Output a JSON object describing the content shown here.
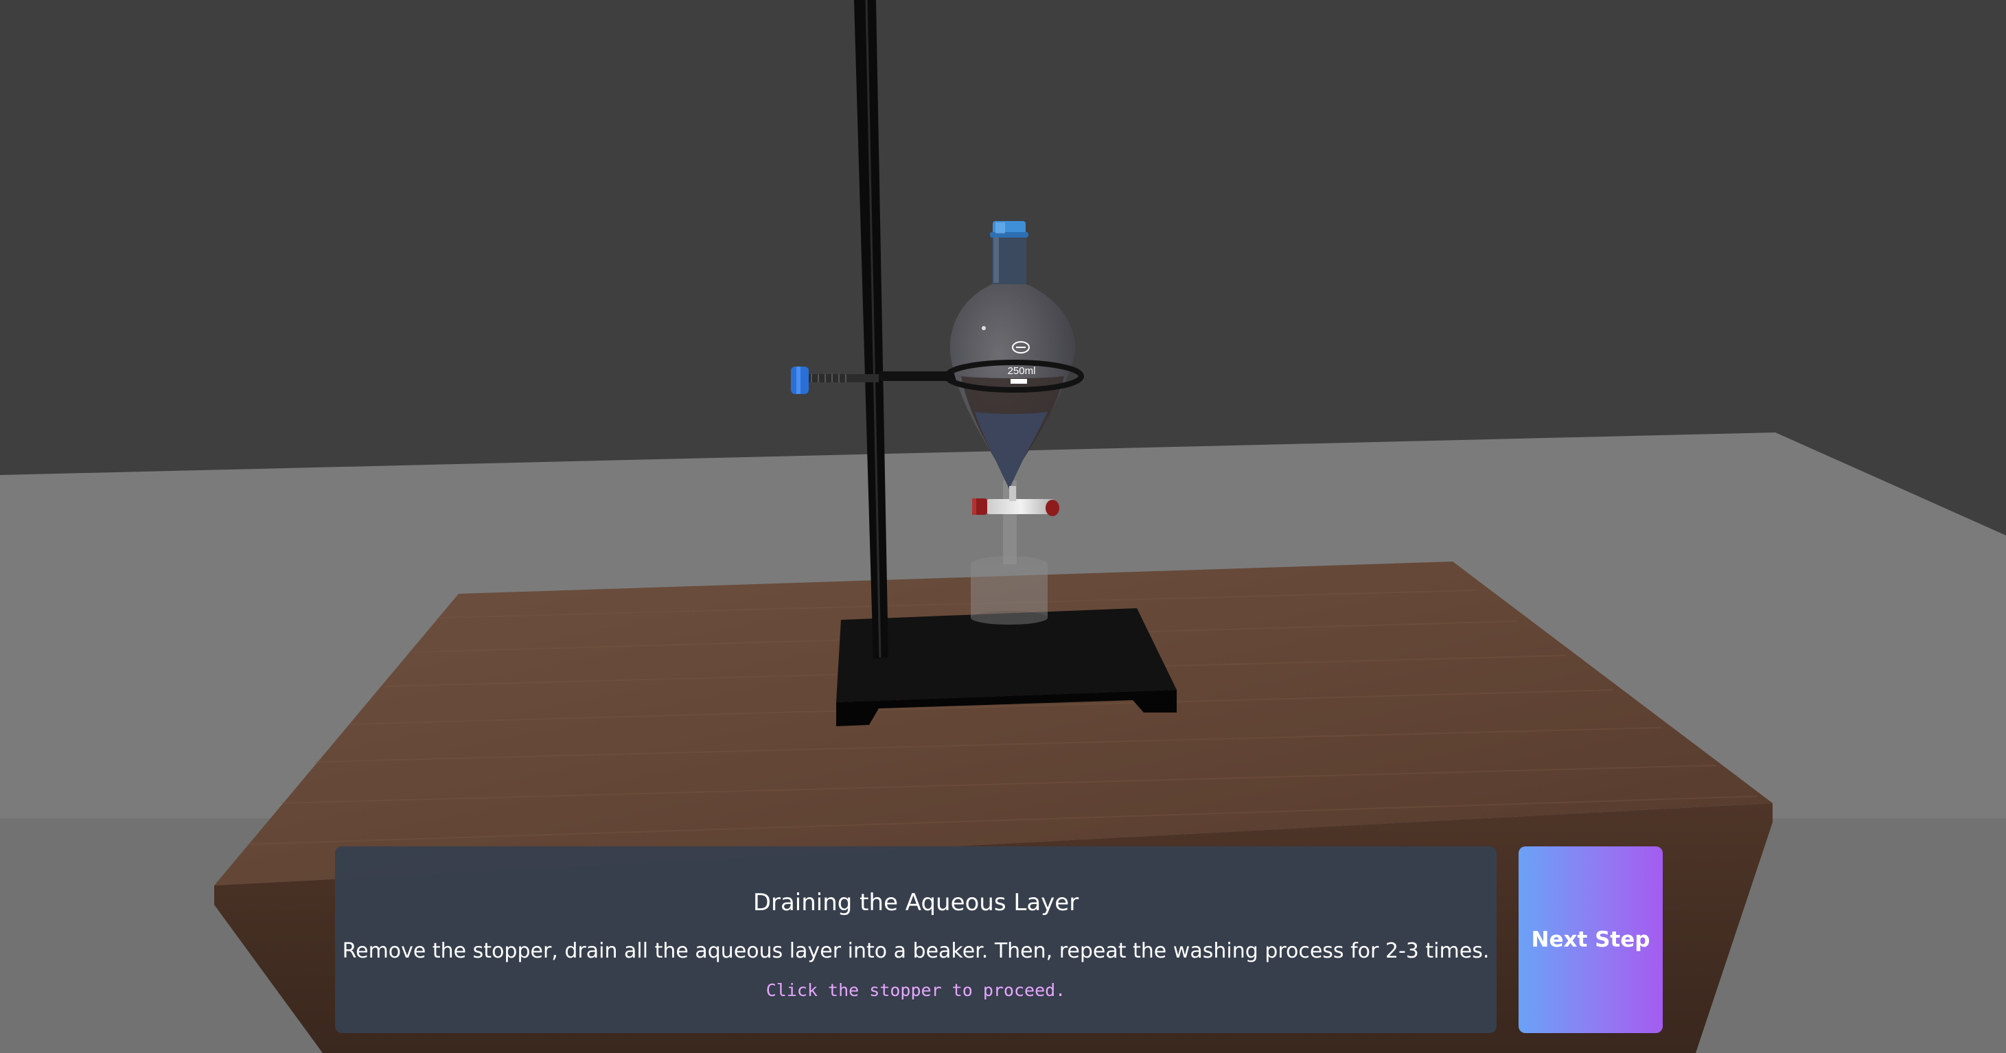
{
  "scene": {
    "flask_volume_label": "250ml",
    "colors": {
      "background": "#3f3f3f",
      "floor": "#7b7b7b",
      "table": "#6a4d3c",
      "stand": "#0a0a0a",
      "clamp_knob": "#2a6fd6",
      "stopper": "#3f8fd8",
      "stopcock_handle": "#8e1c1c"
    }
  },
  "instruction": {
    "title": "Draining the Aqueous Layer",
    "text": "Remove the stopper, drain all the aqueous layer into a beaker. Then, repeat the washing process for 2-3 times.",
    "hint": "Click the stopper to proceed."
  },
  "controls": {
    "next_label": "Next Step"
  }
}
